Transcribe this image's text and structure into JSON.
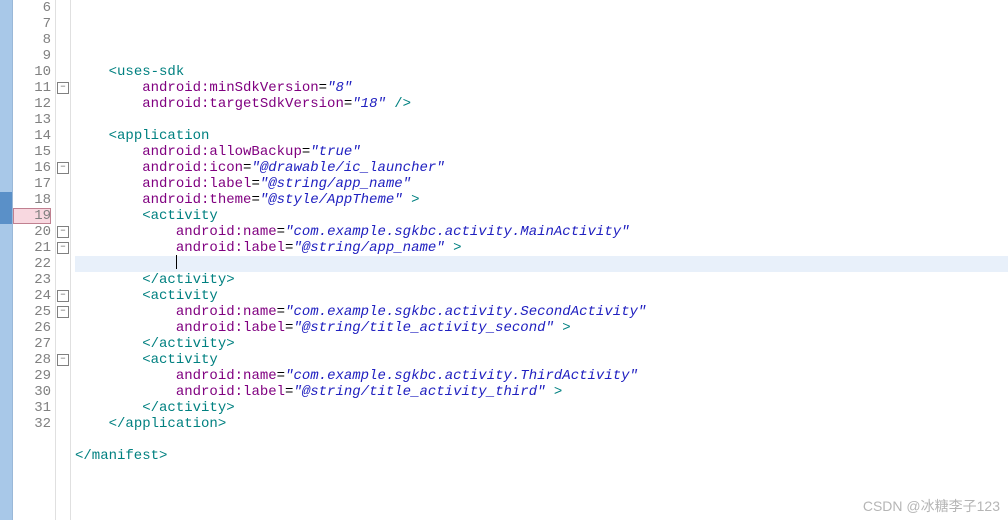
{
  "gutter": {
    "start": 6,
    "end": 32,
    "highlighted_line": 19,
    "foldable_lines": [
      11,
      16,
      20,
      21,
      24,
      25,
      28
    ],
    "fold_mark_lines": [
      18,
      19
    ]
  },
  "code": {
    "lines": [
      {
        "n": 6,
        "indent": 1,
        "segments": []
      },
      {
        "n": 7,
        "indent": 1,
        "segments": [
          {
            "t": "tag",
            "v": "<uses-sdk"
          }
        ]
      },
      {
        "n": 8,
        "indent": 2,
        "segments": [
          {
            "t": "attr",
            "v": "android:minSdkVersion"
          },
          {
            "t": "punc",
            "v": "="
          },
          {
            "t": "str",
            "v": "\"8\""
          }
        ]
      },
      {
        "n": 9,
        "indent": 2,
        "segments": [
          {
            "t": "attr",
            "v": "android:targetSdkVersion"
          },
          {
            "t": "punc",
            "v": "="
          },
          {
            "t": "str",
            "v": "\"18\""
          },
          {
            "t": "tag",
            "v": " />"
          }
        ]
      },
      {
        "n": 10,
        "indent": 0,
        "segments": []
      },
      {
        "n": 11,
        "indent": 1,
        "segments": [
          {
            "t": "tag",
            "v": "<application"
          }
        ]
      },
      {
        "n": 12,
        "indent": 2,
        "segments": [
          {
            "t": "attr",
            "v": "android:allowBackup"
          },
          {
            "t": "punc",
            "v": "="
          },
          {
            "t": "str",
            "v": "\"true\""
          }
        ]
      },
      {
        "n": 13,
        "indent": 2,
        "segments": [
          {
            "t": "attr",
            "v": "android:icon"
          },
          {
            "t": "punc",
            "v": "="
          },
          {
            "t": "str",
            "v": "\"@drawable/ic_launcher\""
          }
        ]
      },
      {
        "n": 14,
        "indent": 2,
        "segments": [
          {
            "t": "attr",
            "v": "android:label"
          },
          {
            "t": "punc",
            "v": "="
          },
          {
            "t": "str",
            "v": "\"@string/app_name\""
          }
        ]
      },
      {
        "n": 15,
        "indent": 2,
        "segments": [
          {
            "t": "attr",
            "v": "android:theme"
          },
          {
            "t": "punc",
            "v": "="
          },
          {
            "t": "str",
            "v": "\"@style/AppTheme\""
          },
          {
            "t": "tag",
            "v": " >"
          }
        ]
      },
      {
        "n": 16,
        "indent": 2,
        "segments": [
          {
            "t": "tag",
            "v": "<activity"
          }
        ]
      },
      {
        "n": 17,
        "indent": 3,
        "segments": [
          {
            "t": "attr",
            "v": "android:name"
          },
          {
            "t": "punc",
            "v": "="
          },
          {
            "t": "str",
            "v": "\"com.example.sgkbc.activity.MainActivity\""
          }
        ]
      },
      {
        "n": 18,
        "indent": 3,
        "segments": [
          {
            "t": "attr",
            "v": "android:label"
          },
          {
            "t": "punc",
            "v": "="
          },
          {
            "t": "str",
            "v": "\"@string/app_name\""
          },
          {
            "t": "tag",
            "v": " >"
          }
        ]
      },
      {
        "n": 19,
        "indent": 3,
        "segments": [],
        "current": true,
        "cursor": true
      },
      {
        "n": 20,
        "indent": 2,
        "segments": [
          {
            "t": "tag",
            "v": "</activity>"
          }
        ]
      },
      {
        "n": 21,
        "indent": 2,
        "segments": [
          {
            "t": "tag",
            "v": "<activity"
          }
        ]
      },
      {
        "n": 22,
        "indent": 3,
        "segments": [
          {
            "t": "attr",
            "v": "android:name"
          },
          {
            "t": "punc",
            "v": "="
          },
          {
            "t": "str",
            "v": "\"com.example.sgkbc.activity.SecondActivity\""
          }
        ]
      },
      {
        "n": 23,
        "indent": 3,
        "segments": [
          {
            "t": "attr",
            "v": "android:label"
          },
          {
            "t": "punc",
            "v": "="
          },
          {
            "t": "str",
            "v": "\"@string/title_activity_second\""
          },
          {
            "t": "tag",
            "v": " >"
          }
        ]
      },
      {
        "n": 24,
        "indent": 2,
        "segments": [
          {
            "t": "tag",
            "v": "</activity>"
          }
        ]
      },
      {
        "n": 25,
        "indent": 2,
        "segments": [
          {
            "t": "tag",
            "v": "<activity"
          }
        ]
      },
      {
        "n": 26,
        "indent": 3,
        "segments": [
          {
            "t": "attr",
            "v": "android:name"
          },
          {
            "t": "punc",
            "v": "="
          },
          {
            "t": "str",
            "v": "\"com.example.sgkbc.activity.ThirdActivity\""
          }
        ]
      },
      {
        "n": 27,
        "indent": 3,
        "segments": [
          {
            "t": "attr",
            "v": "android:label"
          },
          {
            "t": "punc",
            "v": "="
          },
          {
            "t": "str",
            "v": "\"@string/title_activity_third\""
          },
          {
            "t": "tag",
            "v": " >"
          }
        ]
      },
      {
        "n": 28,
        "indent": 2,
        "segments": [
          {
            "t": "tag",
            "v": "</activity>"
          }
        ]
      },
      {
        "n": 29,
        "indent": 1,
        "segments": [
          {
            "t": "tag",
            "v": "</application>"
          }
        ]
      },
      {
        "n": 30,
        "indent": 0,
        "segments": []
      },
      {
        "n": 31,
        "indent": 0,
        "segments": [
          {
            "t": "tag",
            "v": "</manifest>"
          }
        ]
      },
      {
        "n": 32,
        "indent": 0,
        "segments": []
      }
    ]
  },
  "watermark": "CSDN @冰糖李子123"
}
